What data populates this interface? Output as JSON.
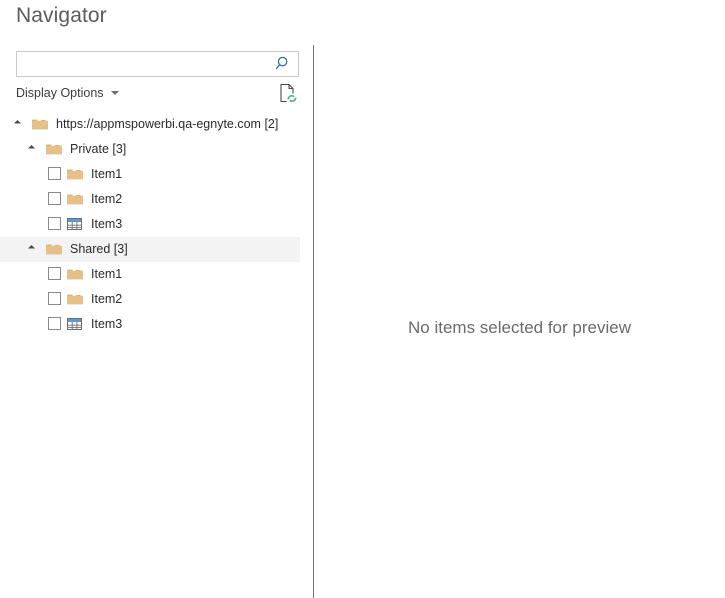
{
  "window": {
    "title": "Navigator"
  },
  "search": {
    "value": "",
    "placeholder": "",
    "icon": "search-icon"
  },
  "toolbar": {
    "display_options_label": "Display Options",
    "display_options_caret": "chevron-down-icon",
    "refresh_icon": "refresh-document-icon"
  },
  "tree": {
    "nodes": [
      {
        "label": "https://appmspowerbi.qa-egnyte.com [2]",
        "level": 0,
        "icon": "folder-icon",
        "expanded": true,
        "has_checkbox": false,
        "selected": false
      },
      {
        "label": "Private [3]",
        "level": 1,
        "icon": "folder-icon",
        "expanded": true,
        "has_checkbox": false,
        "selected": false
      },
      {
        "label": "Item1",
        "level": 2,
        "icon": "folder-icon",
        "expanded": false,
        "has_checkbox": true,
        "checked": false,
        "selected": false
      },
      {
        "label": "Item2",
        "level": 2,
        "icon": "folder-icon",
        "expanded": false,
        "has_checkbox": true,
        "checked": false,
        "selected": false
      },
      {
        "label": "Item3",
        "level": 2,
        "icon": "table-icon",
        "expanded": false,
        "has_checkbox": true,
        "checked": false,
        "selected": false
      },
      {
        "label": "Shared [3]",
        "level": 1,
        "icon": "folder-icon",
        "expanded": true,
        "has_checkbox": false,
        "selected": true
      },
      {
        "label": "Item1",
        "level": 2,
        "icon": "folder-icon",
        "expanded": false,
        "has_checkbox": true,
        "checked": false,
        "selected": false
      },
      {
        "label": "Item2",
        "level": 2,
        "icon": "folder-icon",
        "expanded": false,
        "has_checkbox": true,
        "checked": false,
        "selected": false
      },
      {
        "label": "Item3",
        "level": 2,
        "icon": "table-icon",
        "expanded": false,
        "has_checkbox": true,
        "checked": false,
        "selected": false
      }
    ]
  },
  "preview": {
    "empty_message": "No items selected for preview"
  },
  "colors": {
    "folder": "#e5c089",
    "folder_tab": "#d8b075",
    "table_header": "#5b9bd5",
    "search_icon": "#2f6fa8",
    "refresh_arrow": "#4caf8f",
    "divider": "#767676",
    "selected_row": "#f3f3f3",
    "title_text": "#5c5c5c",
    "body_text": "#2b2b2b",
    "preview_text": "#6b6b6b"
  }
}
